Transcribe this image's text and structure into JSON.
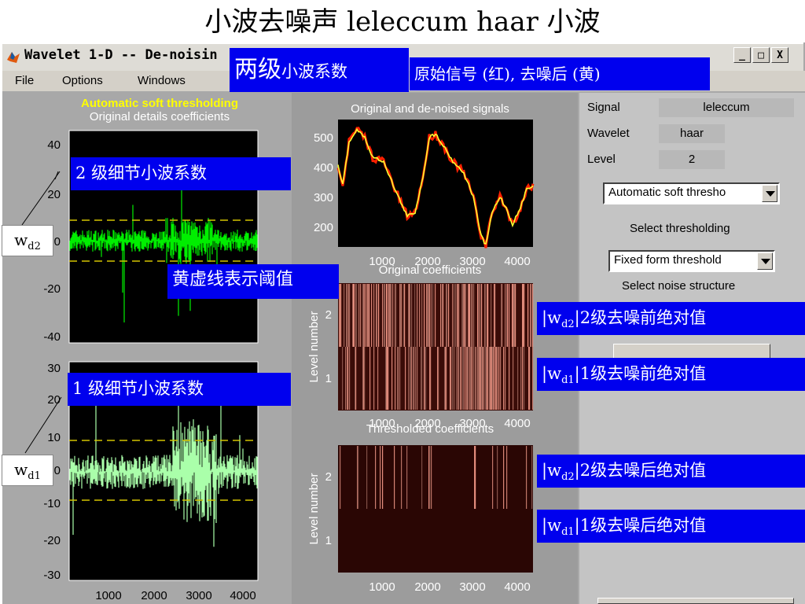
{
  "slide": {
    "title": "小波去噪声 leleccum  haar 小波"
  },
  "window": {
    "title": "Wavelet 1-D  --  De-noisin",
    "controls": {
      "minimize": "_",
      "maximize": "□",
      "close": "X"
    }
  },
  "menu": {
    "items": [
      "File",
      "Options",
      "Windows"
    ]
  },
  "left_panel": {
    "header": "Automatic soft thresholding",
    "subheader": "Original details coefficients",
    "top_axis_ticks": [
      "40",
      "20",
      "0",
      "-20",
      "-40"
    ],
    "bottom_axis_ticks": [
      "30",
      "20",
      "10",
      "0",
      "-10",
      "-20",
      "-30"
    ],
    "x_ticks": [
      "1000",
      "2000",
      "3000",
      "4000"
    ]
  },
  "middle_panel": {
    "signal_title": "Original and de-noised signals",
    "signal_y_ticks": [
      "500",
      "400",
      "300",
      "200"
    ],
    "coef_title": "Original coefficients",
    "thresh_title": "Thresholded coefficients",
    "level_label": "Level number",
    "level_ticks": [
      "2",
      "1"
    ],
    "x_ticks": [
      "1000",
      "2000",
      "3000",
      "4000"
    ]
  },
  "right_panel": {
    "signal_label": "Signal",
    "signal_value": "leleccum",
    "wavelet_label": "Wavelet",
    "wavelet_value": "haar",
    "level_label": "Level",
    "level_value": "2",
    "threshold_method": "Automatic soft thresho",
    "select_thresholding": "Select thresholding",
    "threshold_form": "Fixed form threshold",
    "select_noise": "Select noise structure"
  },
  "annotations": {
    "two_level_big": "两级",
    "two_level_small": "小波系数",
    "legend_note": "原始信号 (红), 去噪后 (黄)",
    "level2_details": "2 级细节小波系数",
    "level1_details": "1 级细节小波系数",
    "threshold_note": "黄虚线表示阈值",
    "wd2_main": "w",
    "wd2_sub": "d2",
    "wd1_main": "w",
    "wd1_sub": "d1",
    "abs_d2_before": "2级去噪前绝对值",
    "abs_d1_before": "1级去噪前绝对值",
    "abs_d2_after": "2级去噪后绝对值",
    "abs_d1_after": "1级去噪后绝对值"
  },
  "colors": {
    "plot_bg": "#000000",
    "detail_d2": "#00ee00",
    "detail_d1": "#aaffaa",
    "threshold_line": "#d4c400",
    "original_signal": "#ff2000",
    "denoised_signal": "#ffff30",
    "annotation_bg": "#0000ee"
  }
}
